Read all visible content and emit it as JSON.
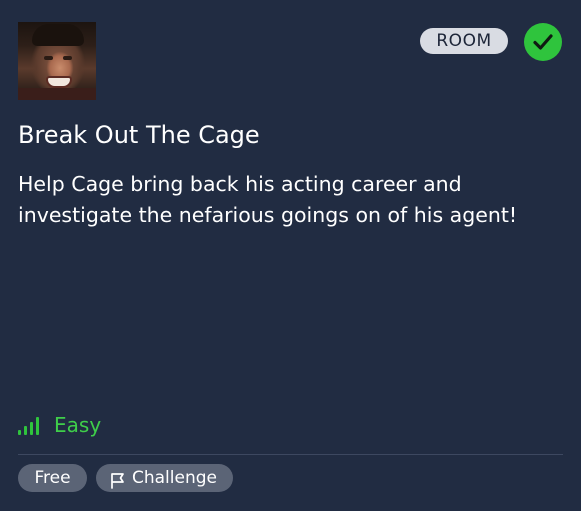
{
  "card": {
    "title": "Break Out The Cage",
    "description": "Help Cage bring back his acting career and investigate the nefarious goings on of his agent!",
    "type_badge": "ROOM",
    "completed_icon": "check-icon",
    "difficulty": {
      "label": "Easy",
      "icon": "signal-bars-icon",
      "color": "#2fc43d"
    },
    "tags": [
      {
        "label": "Free"
      },
      {
        "label": "Challenge",
        "icon": "flag-icon"
      }
    ]
  },
  "colors": {
    "background": "#212c42",
    "badge_bg": "#d9dce3",
    "check_bg": "#2fc43d",
    "tag_bg": "#5b6476"
  }
}
